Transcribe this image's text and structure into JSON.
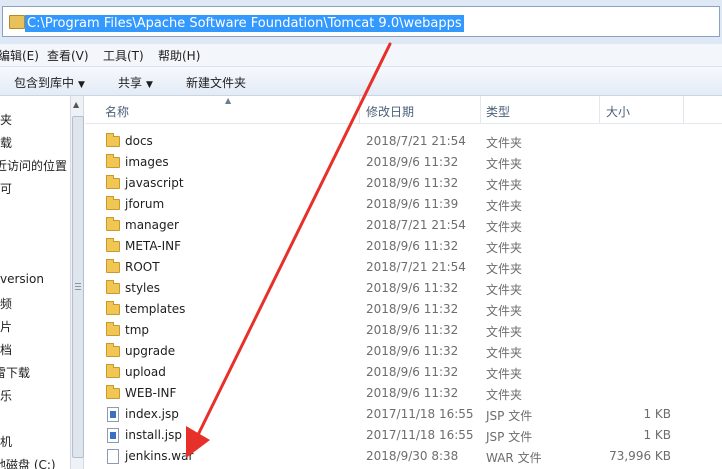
{
  "address": {
    "path": "C:\\Program Files\\Apache Software Foundation\\Tomcat 9.0\\webapps"
  },
  "menu": [
    {
      "label": "编辑(E)"
    },
    {
      "label": "查看(V)"
    },
    {
      "label": "工具(T)"
    },
    {
      "label": "帮助(H)"
    }
  ],
  "toolbar": {
    "include_library": "包含到库中",
    "share": "共享",
    "new_folder": "新建文件夹"
  },
  "nav": [
    {
      "label": "夹"
    },
    {
      "label": "载"
    },
    {
      "label": "近访问的位置"
    },
    {
      "label": "可"
    },
    {
      "label": "version"
    },
    {
      "label": "频"
    },
    {
      "label": "片"
    },
    {
      "label": "档"
    },
    {
      "label": "雷下载"
    },
    {
      "label": "乐"
    },
    {
      "label": "机"
    },
    {
      "label": "地磁盘 (C:)"
    }
  ],
  "columns": {
    "name": "名称",
    "date": "修改日期",
    "type": "类型",
    "size": "大小"
  },
  "files": [
    {
      "name": "docs",
      "date": "2018/7/21 21:54",
      "type": "文件夹",
      "size": "",
      "kind": "folder"
    },
    {
      "name": "images",
      "date": "2018/9/6 11:32",
      "type": "文件夹",
      "size": "",
      "kind": "folder"
    },
    {
      "name": "javascript",
      "date": "2018/9/6 11:32",
      "type": "文件夹",
      "size": "",
      "kind": "folder"
    },
    {
      "name": "jforum",
      "date": "2018/9/6 11:39",
      "type": "文件夹",
      "size": "",
      "kind": "folder"
    },
    {
      "name": "manager",
      "date": "2018/7/21 21:54",
      "type": "文件夹",
      "size": "",
      "kind": "folder"
    },
    {
      "name": "META-INF",
      "date": "2018/9/6 11:32",
      "type": "文件夹",
      "size": "",
      "kind": "folder"
    },
    {
      "name": "ROOT",
      "date": "2018/7/21 21:54",
      "type": "文件夹",
      "size": "",
      "kind": "folder"
    },
    {
      "name": "styles",
      "date": "2018/9/6 11:32",
      "type": "文件夹",
      "size": "",
      "kind": "folder"
    },
    {
      "name": "templates",
      "date": "2018/9/6 11:32",
      "type": "文件夹",
      "size": "",
      "kind": "folder"
    },
    {
      "name": "tmp",
      "date": "2018/9/6 11:32",
      "type": "文件夹",
      "size": "",
      "kind": "folder"
    },
    {
      "name": "upgrade",
      "date": "2018/9/6 11:32",
      "type": "文件夹",
      "size": "",
      "kind": "folder"
    },
    {
      "name": "upload",
      "date": "2018/9/6 11:32",
      "type": "文件夹",
      "size": "",
      "kind": "folder"
    },
    {
      "name": "WEB-INF",
      "date": "2018/9/6 11:32",
      "type": "文件夹",
      "size": "",
      "kind": "folder"
    },
    {
      "name": "index.jsp",
      "date": "2017/11/18 16:55",
      "type": "JSP 文件",
      "size": "1 KB",
      "kind": "jsp"
    },
    {
      "name": "install.jsp",
      "date": "2017/11/18 16:55",
      "type": "JSP 文件",
      "size": "1 KB",
      "kind": "jsp"
    },
    {
      "name": "jenkins.war",
      "date": "2018/9/30 8:38",
      "type": "WAR 文件",
      "size": "73,996 KB",
      "kind": "war"
    }
  ],
  "colors": {
    "selection": "#3399ff",
    "annotation_arrow": "#e8302a",
    "folder": "#f0c755"
  }
}
